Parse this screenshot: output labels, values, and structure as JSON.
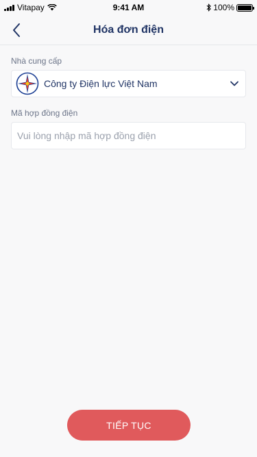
{
  "status_bar": {
    "carrier": "Vitapay",
    "time": "9:41 AM",
    "battery": "100%"
  },
  "header": {
    "title": "Hóa đơn điện",
    "back_icon": "chevron-left-icon"
  },
  "form": {
    "provider_label": "Nhà cung cấp",
    "provider_value": "Công ty Điện lực Việt Nam",
    "contract_label": "Mã hợp đồng điện",
    "contract_placeholder": "Vui lòng nhập mã hợp đồng điện",
    "contract_value": ""
  },
  "actions": {
    "continue_label": "TIẾP TỤC"
  },
  "colors": {
    "primary_text": "#1f3364",
    "accent_button": "#e05a5c",
    "background": "#f8f8f9"
  }
}
